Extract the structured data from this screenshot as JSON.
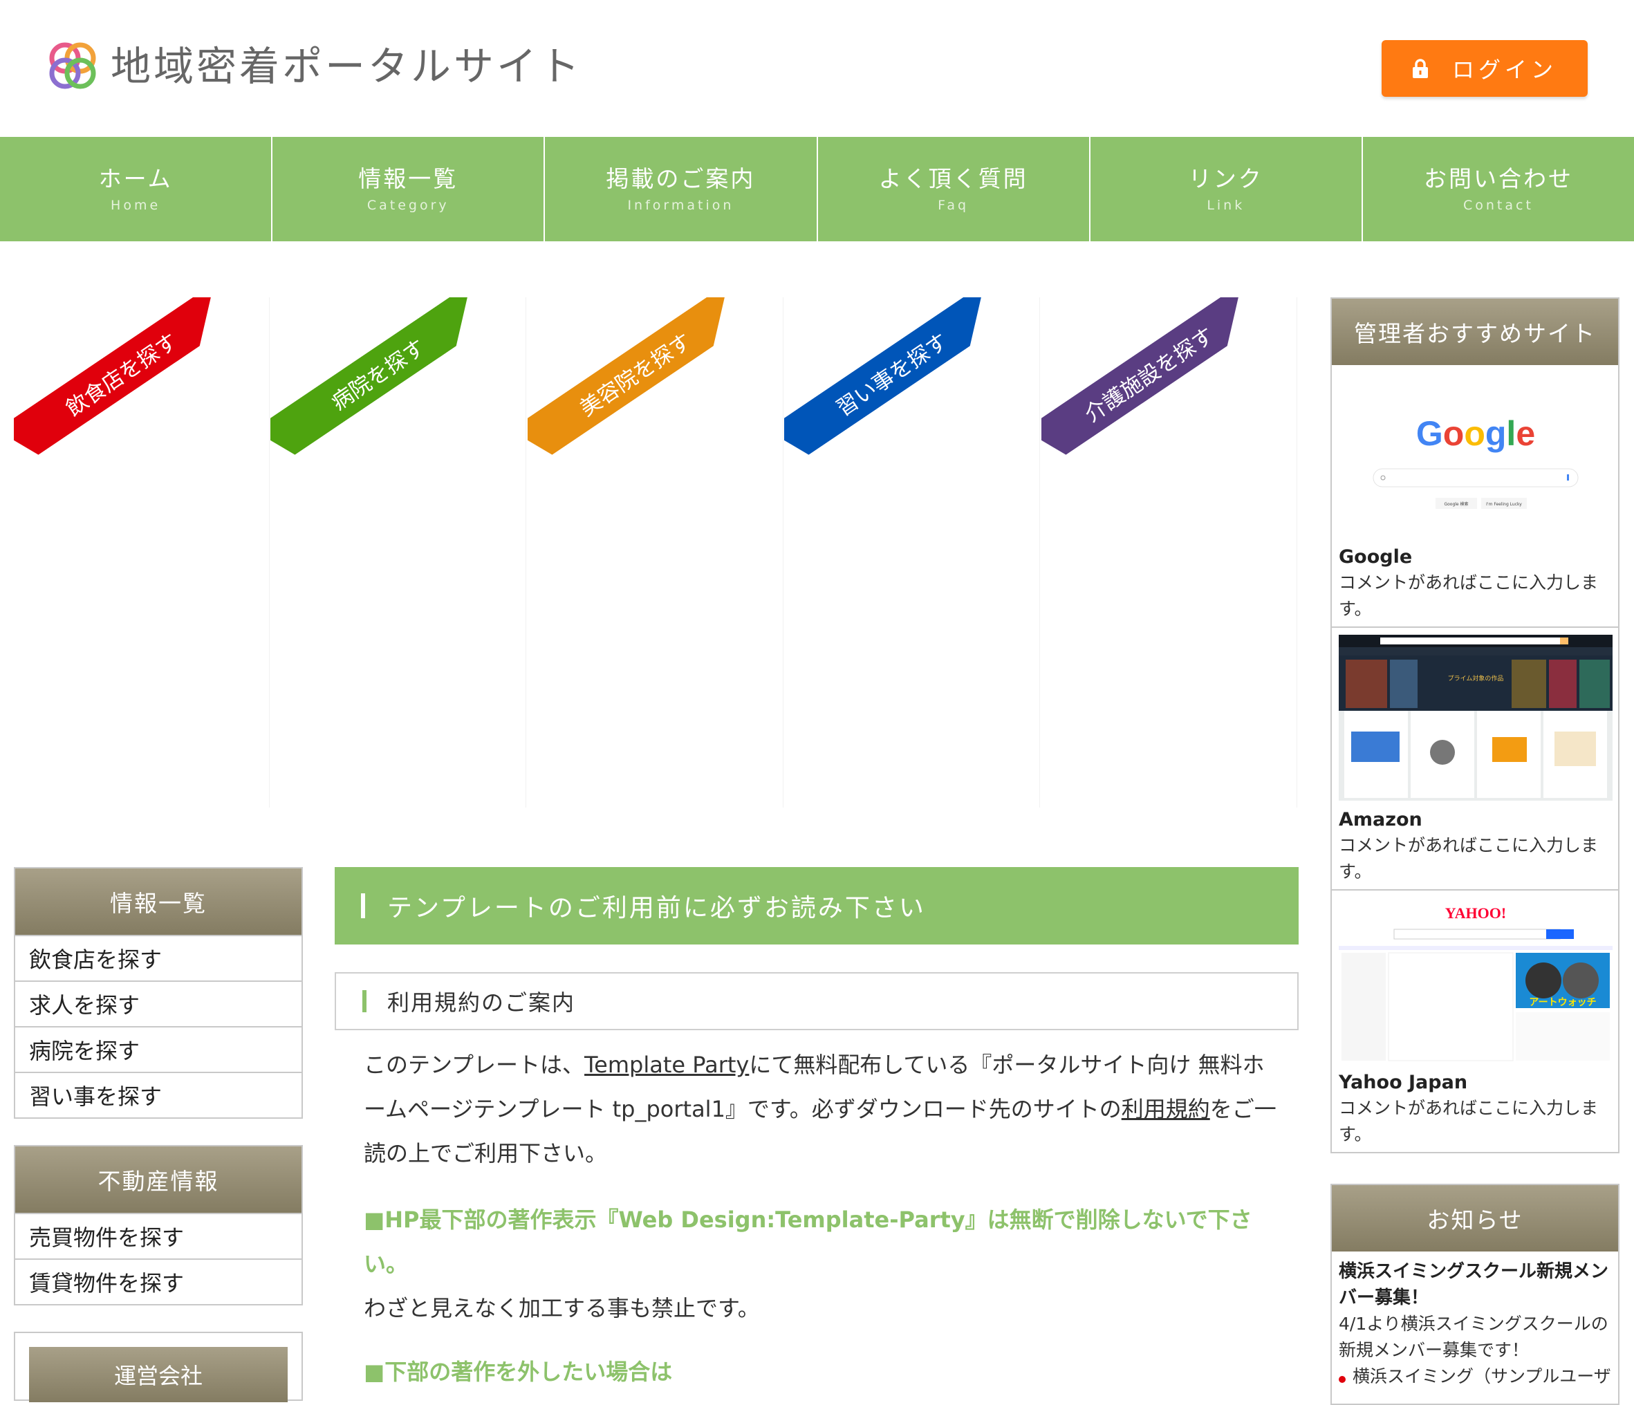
{
  "header": {
    "site_title": "地域密着ポータルサイト",
    "login_label": "ログイン",
    "accent_color": "#ff7a12"
  },
  "nav": [
    {
      "jp": "ホーム",
      "en": "Home"
    },
    {
      "jp": "情報一覧",
      "en": "Category"
    },
    {
      "jp": "掲載のご案内",
      "en": "Information"
    },
    {
      "jp": "よく頂く質問",
      "en": "Faq"
    },
    {
      "jp": "リンク",
      "en": "Link"
    },
    {
      "jp": "お問い合わせ",
      "en": "Contact"
    }
  ],
  "categories": [
    {
      "label": "飲食店を探す",
      "color": "#e0000c"
    },
    {
      "label": "病院を探す",
      "color": "#4ea30f"
    },
    {
      "label": "美容院を探す",
      "color": "#e88f0e"
    },
    {
      "label": "習い事を探す",
      "color": "#0055b8"
    },
    {
      "label": "介護施設を探す",
      "color": "#5a3d82"
    }
  ],
  "left_sidebar": {
    "info": {
      "title": "情報一覧",
      "items": [
        "飲食店を探す",
        "求人を探す",
        "病院を探す",
        "習い事を探す"
      ]
    },
    "realestate": {
      "title": "不動産情報",
      "items": [
        "売買物件を探す",
        "賃貸物件を探す"
      ]
    },
    "company": {
      "title": "運営会社"
    }
  },
  "main": {
    "band_title": "テンプレートのご利用前に必ずお読み下さい",
    "sub_title": "利用規約のご案内",
    "para1_a": "このテンプレートは、",
    "para1_link": "Template Party",
    "para1_b": "にて無料配布している『ポータルサイト向け 無料ホームページテンプレート tp_portal1』です。必ずダウンロード先のサイトの",
    "para1_link2": "利用規約",
    "para1_c": "をご一読の上でご利用下さい。",
    "head2": "■HP最下部の著作表示『Web Design:Template-Party』は無断で削除しないで下さい。",
    "para2": "わざと見えなく加工する事も禁止です。",
    "head3": "■下部の著作を外したい場合は"
  },
  "right_sidebar": {
    "recommend_title": "管理者おすすめサイト",
    "sites": [
      {
        "name": "Google",
        "comment": "コメントがあればここに入力します。"
      },
      {
        "name": "Amazon",
        "comment": "コメントがあればここに入力します。"
      },
      {
        "name": "Yahoo Japan",
        "comment": "コメントがあればここに入力します。"
      }
    ],
    "thumbs": {
      "google_search": "Google 検索",
      "google_lucky": "I'm Feeling Lucky",
      "amazon_banner": "プライム対象の作品",
      "yahoo_banner": "アートウォッチ"
    },
    "news_title": "お知らせ",
    "news": {
      "title": "横浜スイミングスクール新規メンバー募集！",
      "body": "4/1より横浜スイミングスクールの新規メンバー募集です！",
      "author": "横浜スイミング（サンプルユーザ"
    }
  }
}
